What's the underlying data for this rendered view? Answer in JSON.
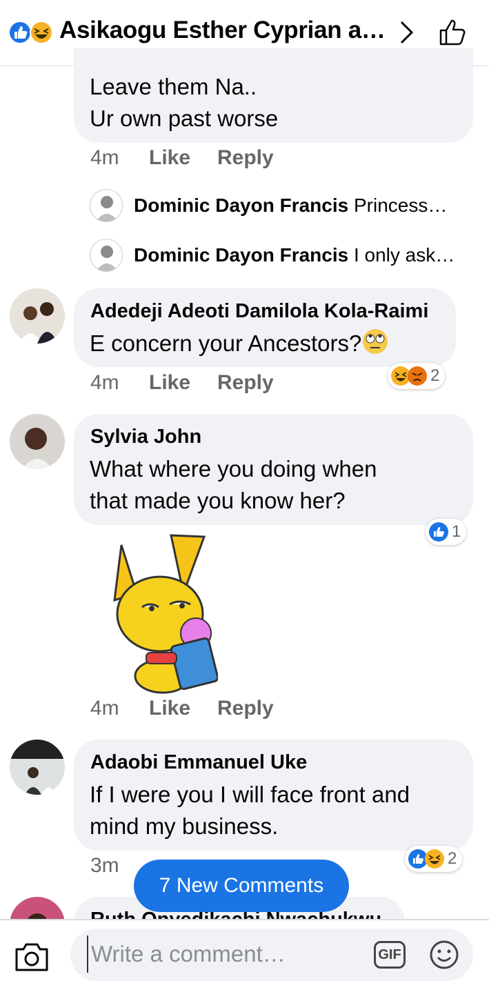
{
  "header": {
    "title": "Asikaogu Esther Cyprian a…"
  },
  "comments": [
    {
      "text_lines": [
        "Leave them Na..",
        "Ur own past worse"
      ],
      "time": "4m",
      "like": "Like",
      "reply": "Reply",
      "replies": [
        {
          "name": "Dominic Dayon Francis",
          "preview": "Princess…"
        },
        {
          "name": "Dominic Dayon Francis",
          "preview": "I only ask…"
        }
      ]
    },
    {
      "name": "Adedeji Adeoti Damilola Kola-Raimi",
      "text_lines": [
        "E concern your Ancestors?"
      ],
      "time": "4m",
      "like": "Like",
      "reply": "Reply",
      "reaction_count": "2"
    },
    {
      "name": "Sylvia John",
      "text_lines": [
        "What where you doing when",
        "that made you know her?"
      ],
      "time": "4m",
      "like": "Like",
      "reply": "Reply",
      "reaction_count": "1"
    },
    {
      "name": "Adaobi Emmanuel Uke",
      "text_lines": [
        "If I were you I will face front and",
        "mind my business."
      ],
      "time": "3m",
      "reaction_count": "2"
    },
    {
      "name": "Ruth Onyedikachi Nwachukwu"
    }
  ],
  "new_comments_label": "7 New Comments",
  "composer": {
    "placeholder": "Write a comment…",
    "gif_label": "GIF"
  },
  "colors": {
    "accent": "#1b74e4",
    "bubble": "#f0f2f5",
    "meta": "#65676b"
  }
}
